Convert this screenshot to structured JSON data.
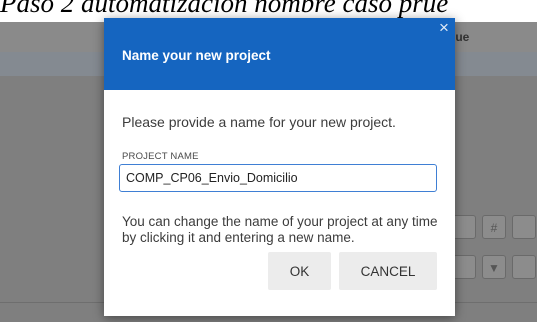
{
  "document": {
    "heading_text": "Paso 2 automatización nombre caso prue"
  },
  "background_app": {
    "column_header": "lue",
    "toolbar_glyph_1": "#",
    "toolbar_glyph_2": "▼"
  },
  "dialog": {
    "title": "Name your new project",
    "close_glyph": "×",
    "prompt": "Please provide a name for your new project.",
    "field_label": "PROJECT NAME",
    "field_value": "COMP_CP06_Envio_Domicilio",
    "hint": "You can change the name of your project at any time by clicking it and entering a new name.",
    "ok_label": "OK",
    "cancel_label": "CANCEL"
  },
  "colors": {
    "header_blue": "#1565c0",
    "overlay_gray": "#7f7f7f",
    "button_gray": "#ececec",
    "input_border": "#3f7fd4"
  }
}
